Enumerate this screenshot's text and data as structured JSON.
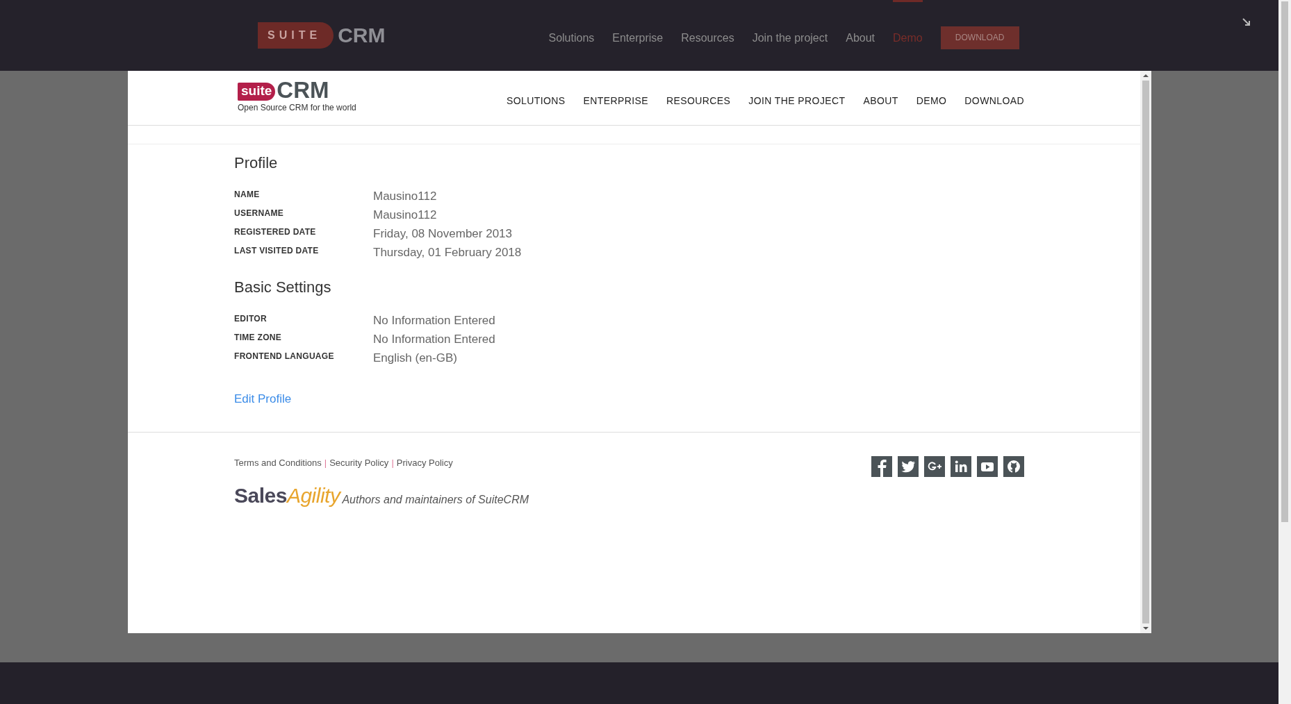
{
  "top_bar": {
    "logo": {
      "badge": "SUITE",
      "word": "CRM"
    },
    "nav": [
      {
        "label": "Solutions",
        "selected": false
      },
      {
        "label": "Enterprise",
        "selected": false
      },
      {
        "label": "Resources",
        "selected": false
      },
      {
        "label": "Join the project",
        "selected": false
      },
      {
        "label": "About",
        "selected": false
      },
      {
        "label": "Demo",
        "selected": true
      }
    ],
    "download_button": "DOWNLOAD"
  },
  "site_header": {
    "logo": {
      "badge": "suite",
      "word": "CRM"
    },
    "tagline": "Open Source CRM for the world",
    "nav": [
      "SOLUTIONS",
      "ENTERPRISE",
      "RESOURCES",
      "JOIN THE PROJECT",
      "ABOUT",
      "DEMO",
      "DOWNLOAD"
    ]
  },
  "sections": [
    {
      "title": "Profile",
      "fields": [
        {
          "label": "NAME",
          "value": "Mausino112"
        },
        {
          "label": "USERNAME",
          "value": "Mausino112"
        },
        {
          "label": "REGISTERED DATE",
          "value": "Friday, 08 November 2013"
        },
        {
          "label": "LAST VISITED DATE",
          "value": "Thursday, 01 February 2018"
        }
      ]
    },
    {
      "title": "Basic Settings",
      "fields": [
        {
          "label": "EDITOR",
          "value": "No Information Entered"
        },
        {
          "label": "TIME ZONE",
          "value": "No Information Entered"
        },
        {
          "label": "FRONTEND LANGUAGE",
          "value": "English (en-GB)"
        }
      ]
    }
  ],
  "edit_link": "Edit Profile",
  "footer": {
    "links": [
      "Terms and Conditions",
      "Security Policy",
      "Privacy Policy"
    ],
    "separator": "|",
    "social": [
      {
        "kind": "facebook"
      },
      {
        "kind": "twitter"
      },
      {
        "kind": "googleplus"
      },
      {
        "kind": "linkedin"
      },
      {
        "kind": "youtube"
      },
      {
        "kind": "github"
      }
    ],
    "brand": {
      "first": "Sales",
      "second": "Agility"
    },
    "tagline": "Authors and maintainers of SuiteCRM"
  }
}
